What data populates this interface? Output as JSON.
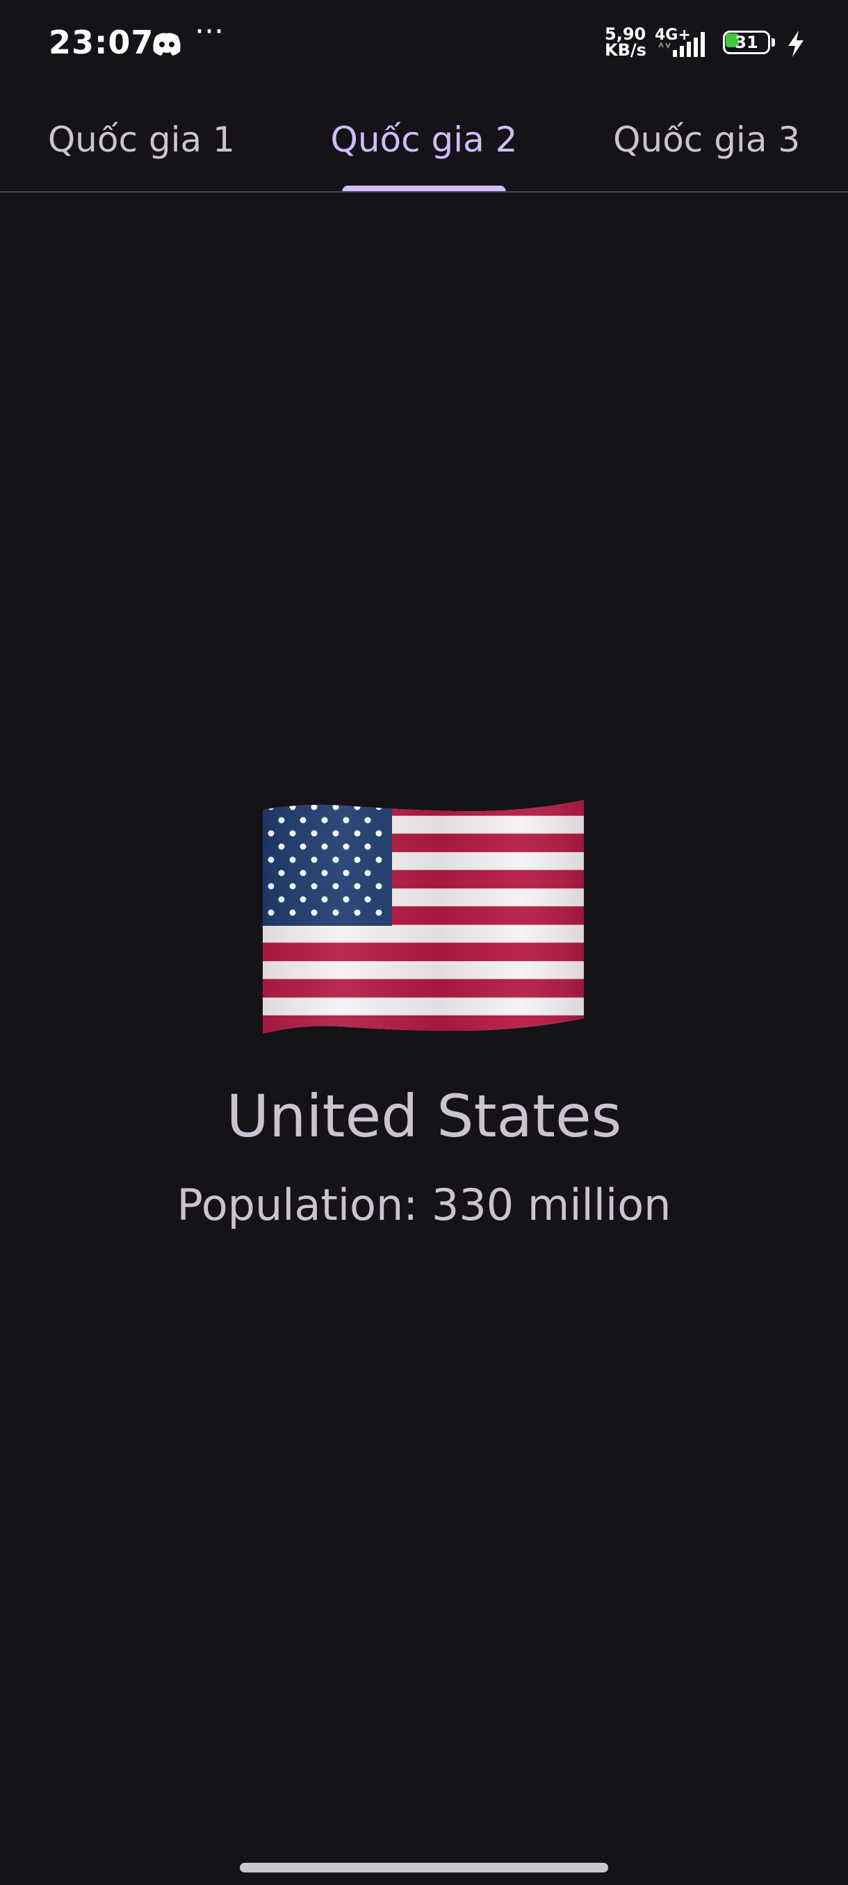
{
  "status_bar": {
    "time": "23:07",
    "app_icon": "discord-icon",
    "more": "···",
    "net_speed_value": "5,90",
    "net_speed_unit": "KB/s",
    "net_type": "4G+",
    "signal_icon": "signal-bars-icon",
    "battery_level": "31",
    "battery_fraction": 0.31,
    "charging_icon": "lightning-bolt-icon"
  },
  "tabs": [
    {
      "label": "Quốc gia 1",
      "active": false
    },
    {
      "label": "Quốc gia 2",
      "active": true
    },
    {
      "label": "Quốc gia 3",
      "active": false
    }
  ],
  "country": {
    "flag_icon": "us-flag-icon",
    "name": "United States",
    "population": "Population: 330 million"
  },
  "colors": {
    "background": "#151218",
    "accent": "#d0bcff",
    "text": "#cac4d0",
    "battery_green": "#3ec63e"
  }
}
